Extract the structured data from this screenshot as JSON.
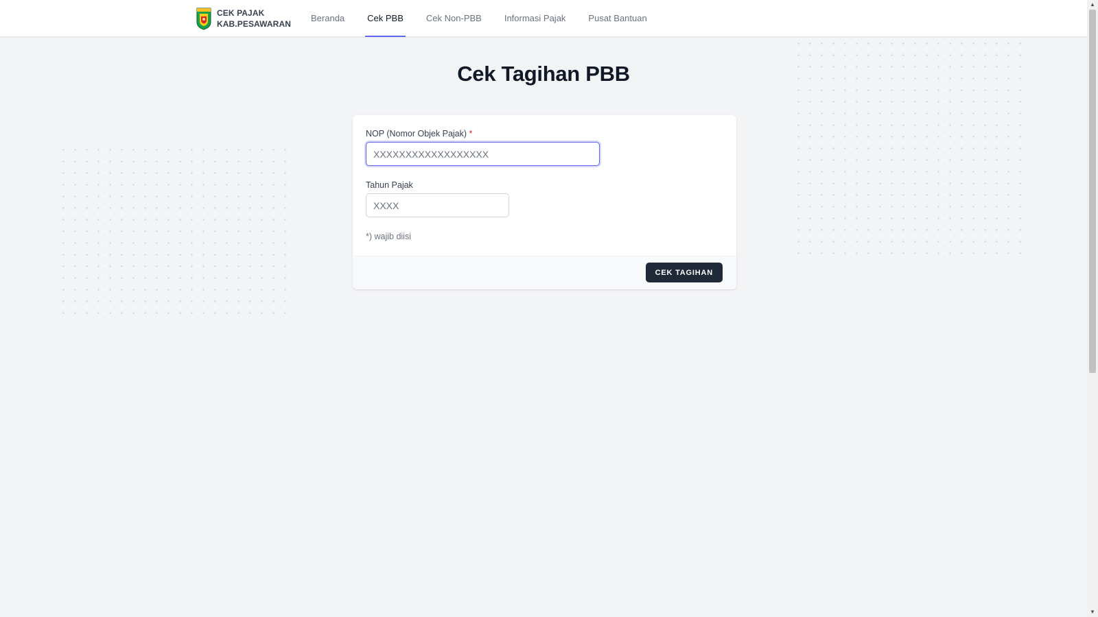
{
  "header": {
    "brand_line1": "CEK PAJAK",
    "brand_line2": "KAB.PESAWARAN",
    "nav": [
      {
        "label": "Beranda",
        "active": false
      },
      {
        "label": "Cek PBB",
        "active": true
      },
      {
        "label": "Cek Non-PBB",
        "active": false
      },
      {
        "label": "Informasi Pajak",
        "active": false
      },
      {
        "label": "Pusat Bantuan",
        "active": false
      }
    ]
  },
  "main": {
    "title": "Cek Tagihan PBB"
  },
  "form": {
    "nop_label": "NOP (Nomor Objek Pajak)",
    "required_mark": "*",
    "nop_value": "",
    "nop_placeholder": "XXXXXXXXXXXXXXXXXX",
    "tahun_label": "Tahun Pajak",
    "tahun_value": "",
    "tahun_placeholder": "XXXX",
    "note": "*) wajib diisi",
    "submit_label": "CEK TAGIHAN"
  },
  "icons": {
    "brand_logo": "pesawaran-shield-logo",
    "scroll_up": "arrow-up-icon",
    "scroll_down": "arrow-down-icon"
  },
  "colors": {
    "accent": "#6366f1",
    "button_bg": "#1f2937",
    "required": "#dc2626",
    "page_bg": "#f3f4f6"
  }
}
